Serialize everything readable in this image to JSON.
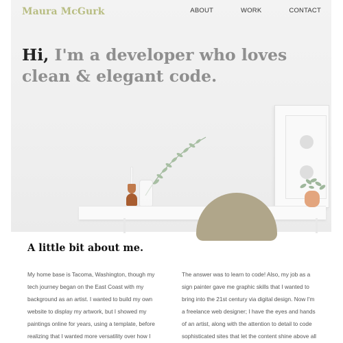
{
  "header": {
    "logo": "Maura McGurk",
    "nav": [
      "ABOUT",
      "WORK",
      "CONTACT"
    ]
  },
  "hero": {
    "greeting": "Hi,",
    "headline_rest": " I'm a developer who loves clean & elegant code."
  },
  "about": {
    "title": "A little bit about me.",
    "column1": "My home base is Tacoma, Washington, though my tech journey began on the East Coast with my background as an artist. I wanted to build my own website to display my artwork, but I showed my paintings online for years, using a template, before realizing that I wanted more versatility over how I presented my work.",
    "column2": "The answer was to learn to code! Also, my job as a sign painter gave me graphic skills that I wanted to bring into the 21st century via digital design. Now I'm a freelance web designer; I have the eyes and hands of an artist, along with the attention to detail to code sophisticated sites that let the content shine above all else."
  },
  "colors": {
    "logo": "#b8bd82",
    "headline_dark": "#222222",
    "headline_gray": "#8f8f8f",
    "body_text": "#555555"
  }
}
